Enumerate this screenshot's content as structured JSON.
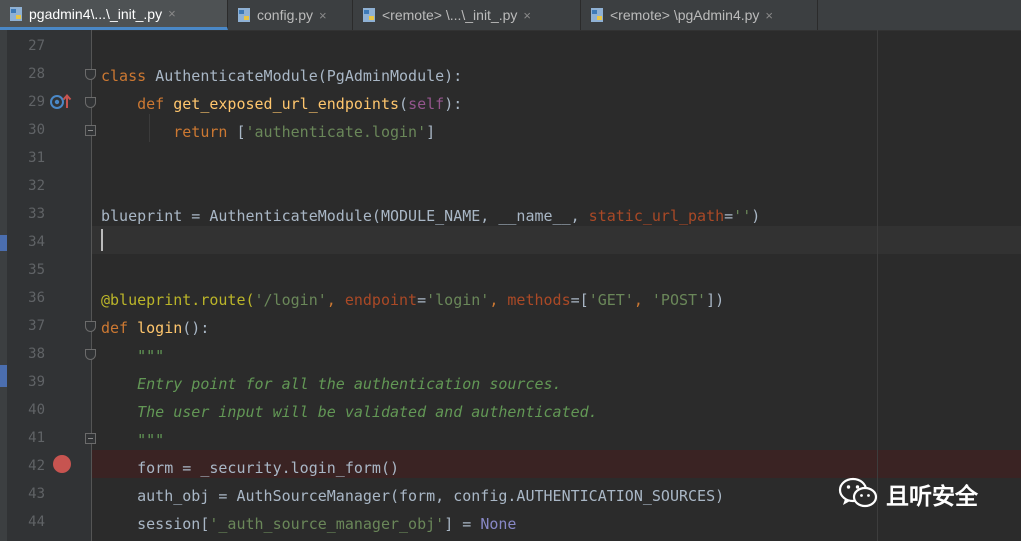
{
  "tabs": [
    {
      "label": "pgadmin4\\...\\_init_.py",
      "active": true
    },
    {
      "label": "config.py",
      "active": false
    },
    {
      "label": "<remote> \\...\\_init_.py",
      "active": false
    },
    {
      "label": "<remote> \\pgAdmin4.py",
      "active": false
    }
  ],
  "close_glyph": "×",
  "line_numbers": [
    "27",
    "28",
    "29",
    "30",
    "31",
    "32",
    "33",
    "34",
    "35",
    "36",
    "37",
    "38",
    "39",
    "40",
    "41",
    "42",
    "43",
    "44"
  ],
  "code": {
    "l28": {
      "kw": "class",
      "name": "AuthenticateModule",
      "rest": "(PgAdminModule):"
    },
    "l29": {
      "kw": "def",
      "name": "get_exposed_url_endpoints",
      "open": "(",
      "self": "self",
      "close": "):"
    },
    "l30": {
      "kw": "return",
      "open": "[",
      "str": "'authenticate.login'",
      "close": "]"
    },
    "l33": {
      "a": "blueprint = AuthenticateModule(MODULE_NAME, __name__, ",
      "param": "static_url_path",
      "eq": "=",
      "str": "''",
      "close": ")"
    },
    "l36": {
      "deco": "@blueprint.route(",
      "s1": "'/login'",
      "c1": ", ",
      "p1": "endpoint",
      "e1": "=",
      "s2": "'login'",
      "c2": ", ",
      "p2": "methods",
      "e2": "=[",
      "s3": "'GET'",
      "c3": ", ",
      "s4": "'POST'",
      "close": "])"
    },
    "l37": {
      "kw": "def",
      "name": "login",
      "rest": "():"
    },
    "l38": {
      "doc": "\"\"\""
    },
    "l39": {
      "doc": "Entry point for all the authentication sources."
    },
    "l40": {
      "doc": "The user input will be validated and authenticated."
    },
    "l41": {
      "doc": "\"\"\""
    },
    "l42": {
      "text": "form = _security.login_form()"
    },
    "l43": {
      "text": "auth_obj = AuthSourceManager(form, config.AUTHENTICATION_SOURCES)"
    },
    "l44": {
      "a": "session[",
      "str": "'_auth_source_manager_obj'",
      "b": "] = ",
      "none": "None"
    }
  },
  "watermark": {
    "text": "且听安全",
    "icon": "wechat-icon"
  },
  "colors": {
    "keyword": "#cc7832",
    "function": "#ffc66d",
    "string": "#6a8759",
    "breakpoint": "#c75450"
  }
}
